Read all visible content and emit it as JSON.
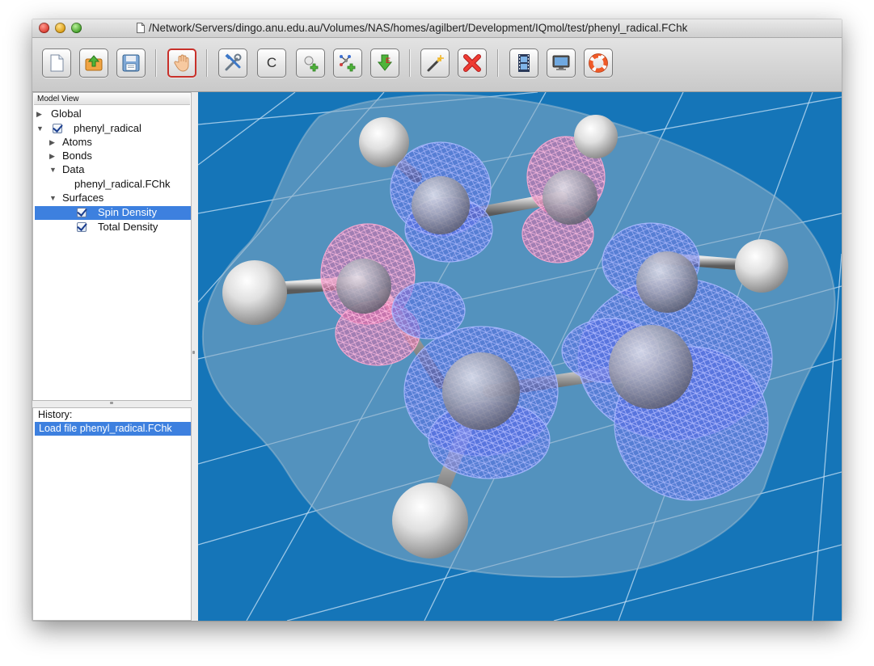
{
  "window": {
    "title": "/Network/Servers/dingo.anu.edu.au/Volumes/NAS/homes/agilbert/Development/IQmol/test/phenyl_radical.FChk"
  },
  "toolbar": {
    "buttons": [
      {
        "name": "new-file",
        "icon": "new-document-icon"
      },
      {
        "name": "open-file",
        "icon": "open-folder-icon"
      },
      {
        "name": "save-file",
        "icon": "floppy-disk-icon"
      },
      {
        "name": "manipulate",
        "icon": "hand-icon",
        "active": true
      },
      {
        "name": "build",
        "icon": "tools-icon"
      },
      {
        "name": "element",
        "icon": "element-icon",
        "label": "C"
      },
      {
        "name": "add-hydrogens",
        "icon": "add-atom-icon"
      },
      {
        "name": "add-fragment",
        "icon": "add-fragment-icon"
      },
      {
        "name": "minimize",
        "icon": "energy-minimize-icon"
      },
      {
        "name": "select",
        "icon": "magic-wand-icon"
      },
      {
        "name": "delete",
        "icon": "delete-x-icon"
      },
      {
        "name": "record",
        "icon": "film-strip-icon"
      },
      {
        "name": "fullscreen",
        "icon": "monitor-icon"
      },
      {
        "name": "help",
        "icon": "life-ring-icon"
      }
    ]
  },
  "model_view": {
    "header": "Model View",
    "items": [
      {
        "label": "Global",
        "level": 0,
        "expanded": false
      },
      {
        "label": "phenyl_radical",
        "level": 0,
        "expanded": true,
        "checked": true
      },
      {
        "label": "Atoms",
        "level": 1,
        "expanded": false
      },
      {
        "label": "Bonds",
        "level": 1,
        "expanded": false
      },
      {
        "label": "Data",
        "level": 1,
        "expanded": true
      },
      {
        "label": "phenyl_radical.FChk",
        "level": 2
      },
      {
        "label": "Surfaces",
        "level": 1,
        "expanded": true
      },
      {
        "label": "Spin Density",
        "level": 2,
        "checked": true,
        "selected": true
      },
      {
        "label": "Total Density",
        "level": 2,
        "checked": true
      }
    ]
  },
  "history": {
    "label": "History:",
    "items": [
      "Load file phenyl_radical.FChk"
    ]
  },
  "colors": {
    "background": "#1575b8",
    "spin_alpha": "#5a6ee6",
    "spin_beta": "#e66ea8",
    "total_density": "#7fa7c2",
    "selection": "#3d80df"
  }
}
